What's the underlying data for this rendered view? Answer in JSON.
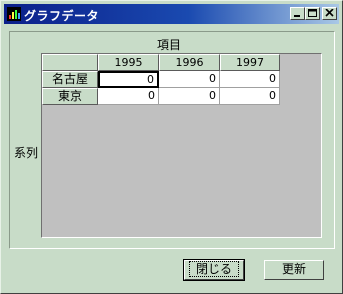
{
  "window": {
    "title": "グラフデータ",
    "icon": "app-graph-icon",
    "controls": {
      "minimize_icon": "minimize-icon",
      "maximize_icon": "maximize-icon",
      "close_icon": "close-icon"
    }
  },
  "grid": {
    "column_axis_label": "項目",
    "row_axis_label": "系列",
    "columns": [
      "1995",
      "1996",
      "1997"
    ],
    "rows": [
      {
        "label": "名古屋",
        "values": [
          "0",
          "0",
          "0"
        ]
      },
      {
        "label": "東京",
        "values": [
          "0",
          "0",
          "0"
        ]
      }
    ]
  },
  "buttons": {
    "close_label": "閉じる",
    "update_label": "更新"
  }
}
